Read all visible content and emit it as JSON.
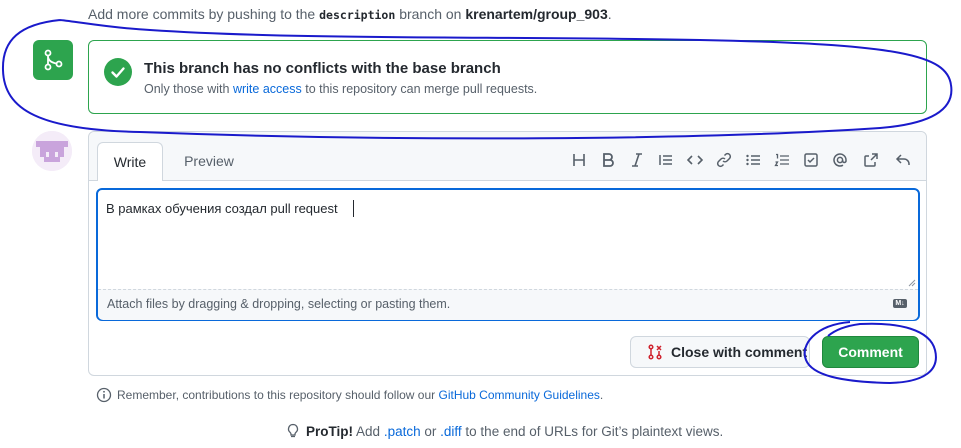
{
  "hint": {
    "prefix": "Add more commits by pushing to the",
    "branch": "description",
    "middle": "branch on",
    "repo": "krenartem/group_903",
    "suffix": "."
  },
  "merge_status": {
    "title": "This branch has no conflicts with the base branch",
    "sub_prefix": "Only those with",
    "sub_link": "write access",
    "sub_suffix": "to this repository can merge pull requests."
  },
  "editor": {
    "tabs": [
      {
        "label": "Write",
        "active": true
      },
      {
        "label": "Preview",
        "active": false
      }
    ],
    "toolbar": [
      "heading-icon",
      "bold-icon",
      "italic-icon",
      "quote-icon",
      "code-icon",
      "link-icon",
      "unordered-list-icon",
      "ordered-list-icon",
      "task-list-icon",
      "mention-icon",
      "cross-reference-icon",
      "reply-icon"
    ],
    "value": "В рамках обучения создал pull request",
    "attach_hint": "Attach files by dragging & dropping, selecting or pasting them.",
    "markdown_badge": "M↓"
  },
  "actions": {
    "close_label": "Close with comment",
    "comment_label": "Comment"
  },
  "footer": {
    "guideline_prefix": "Remember, contributions to this repository should follow our",
    "guideline_link": "GitHub Community Guidelines",
    "guideline_suffix": ".",
    "protip_label": "ProTip!",
    "protip_prefix": "Add",
    "protip_patch": ".patch",
    "protip_or": "or",
    "protip_diff": ".diff",
    "protip_suffix": "to the end of URLs for Git’s plaintext views."
  },
  "colors": {
    "accent_green": "#2da44e",
    "link_blue": "#0969da",
    "annotation_blue": "#1a1acb"
  }
}
